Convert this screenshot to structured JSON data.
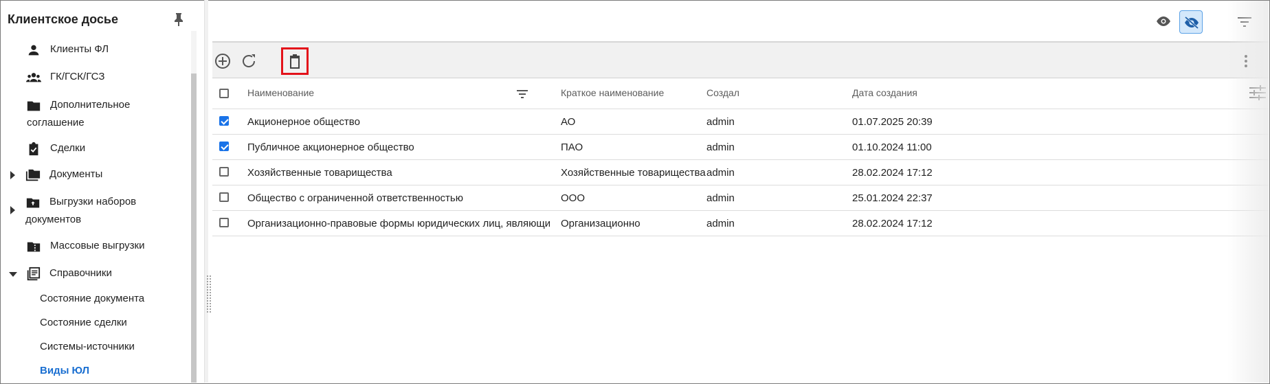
{
  "sidebar": {
    "title": "Клиентское досье",
    "items": [
      {
        "label": "Клиенты ФЛ",
        "icon": "person-icon"
      },
      {
        "label": "ГК/ГСК/ГСЗ",
        "icon": "group-icon"
      },
      {
        "label_line1": "Дополнительное",
        "label_line2": "соглашение",
        "icon": "folder-icon"
      },
      {
        "label": "Сделки",
        "icon": "clipboard-check-icon"
      },
      {
        "label": "Документы",
        "icon": "folders-icon",
        "expandable": true
      },
      {
        "label_line1": "Выгрузки наборов",
        "label_line2": "документов",
        "icon": "folder-upload-icon",
        "expandable": true
      },
      {
        "label": "Массовые выгрузки",
        "icon": "folder-zip-icon"
      },
      {
        "label": "Справочники",
        "icon": "library-icon",
        "expanded": true
      }
    ],
    "subitems": [
      {
        "label": "Состояние документа"
      },
      {
        "label": "Состояние сделки"
      },
      {
        "label": "Системы-источники"
      },
      {
        "label": "Виды ЮЛ",
        "active": true
      }
    ]
  },
  "grid": {
    "columns": [
      "Наименование",
      "Краткое наименование",
      "Создал",
      "Дата создания"
    ],
    "rows": [
      {
        "checked": true,
        "name": "Акционерное общество",
        "short": "АО",
        "creator": "admin",
        "date": "01.07.2025 20:39"
      },
      {
        "checked": true,
        "name": "Публичное акционерное общество",
        "short": "ПАО",
        "creator": "admin",
        "date": "01.10.2024 11:00"
      },
      {
        "checked": false,
        "name": "Хозяйственные товарищества",
        "short": "Хозяйственные товарищества",
        "creator": "admin",
        "date": "28.02.2024 17:12"
      },
      {
        "checked": false,
        "name": "Общество с ограниченной ответственностью",
        "short": "ООО",
        "creator": "admin",
        "date": "25.01.2024 22:37"
      },
      {
        "checked": false,
        "name": "Организационно-правовые формы юридических лиц, являющихся ко...",
        "short": "Организационно",
        "creator": "admin",
        "date": "28.02.2024 17:12"
      }
    ]
  },
  "colors": {
    "accent": "#1a73e8",
    "active_link": "#1a6fd1",
    "highlight": "#e3121a"
  }
}
